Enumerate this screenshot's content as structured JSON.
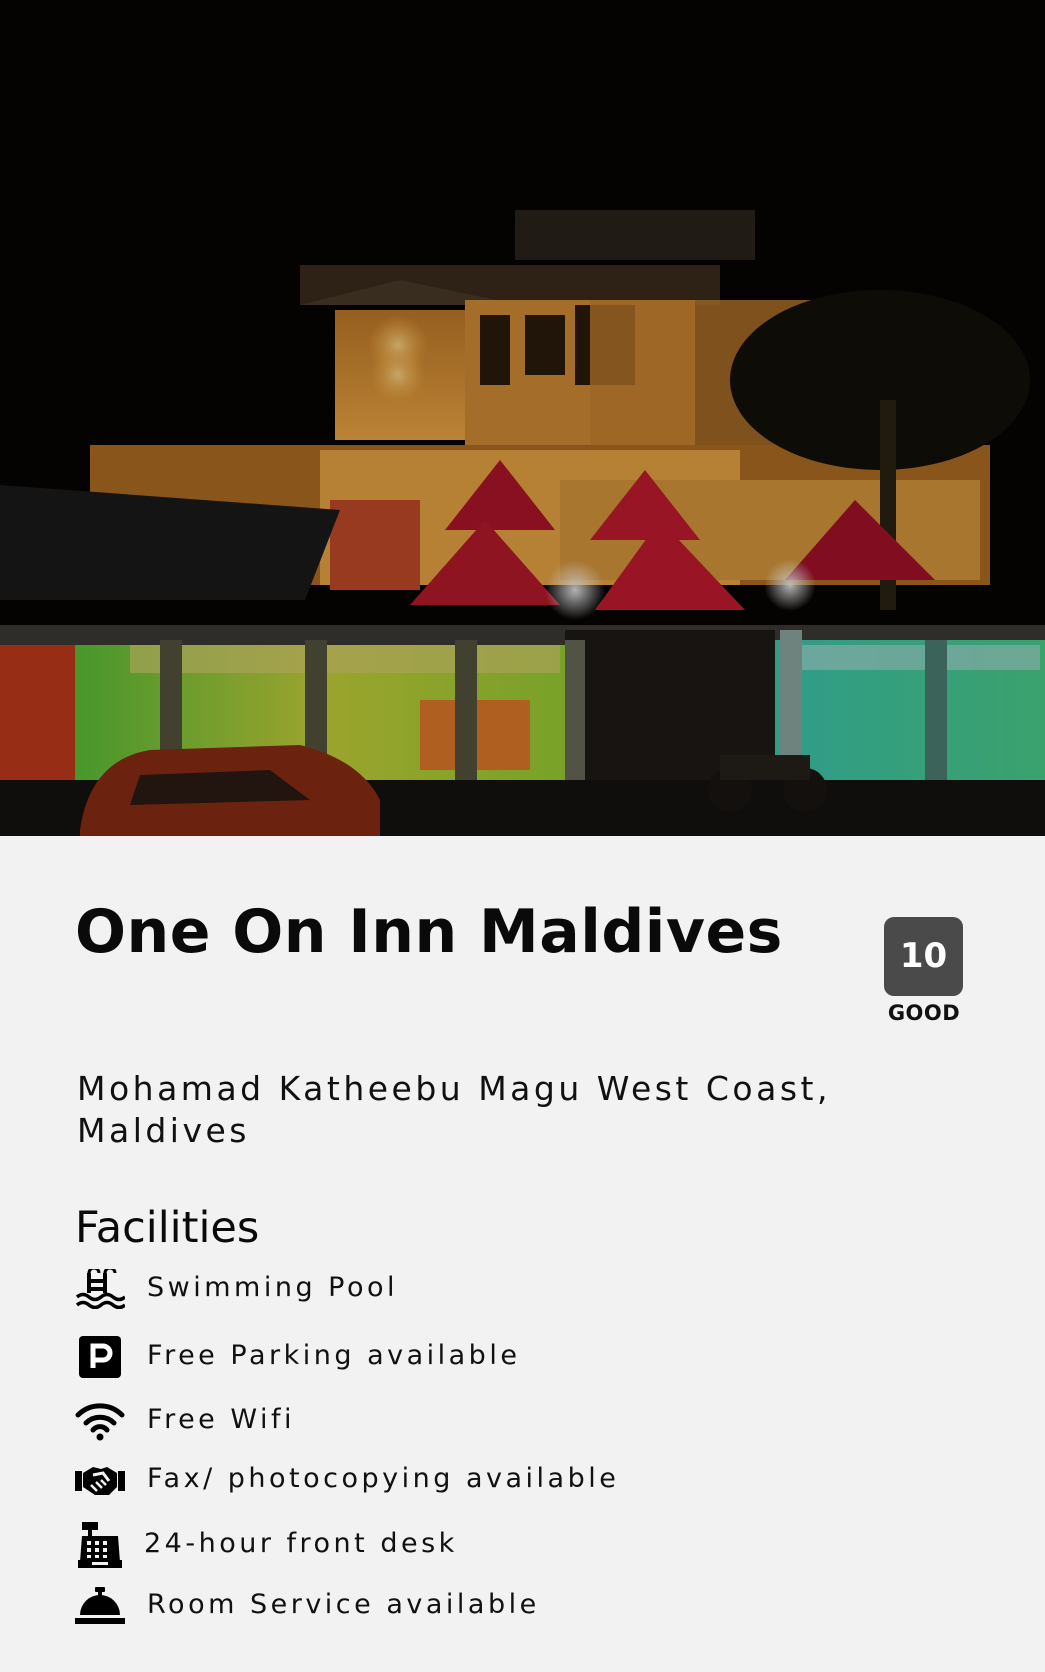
{
  "hotel": {
    "name": "One On Inn Maldives",
    "address": "Mohamad Katheebu Magu West Coast, Maldives",
    "photo_icon": "hotel-night-photo"
  },
  "rating": {
    "score": "10",
    "label": "GOOD",
    "badge_color": "#4a4a4a"
  },
  "facilities": {
    "heading": "Facilities",
    "items": [
      {
        "label": "Swimming Pool",
        "icon": "swimming-pool-icon"
      },
      {
        "label": "Free Parking available",
        "icon": "parking-icon"
      },
      {
        "label": "Free Wifi",
        "icon": "wifi-icon"
      },
      {
        "label": "Fax/ photocopying available",
        "icon": "handshake-icon"
      },
      {
        "label": "24-hour front desk",
        "icon": "cash-register-icon"
      },
      {
        "label": "Room Service available",
        "icon": "concierge-bell-icon"
      }
    ]
  }
}
